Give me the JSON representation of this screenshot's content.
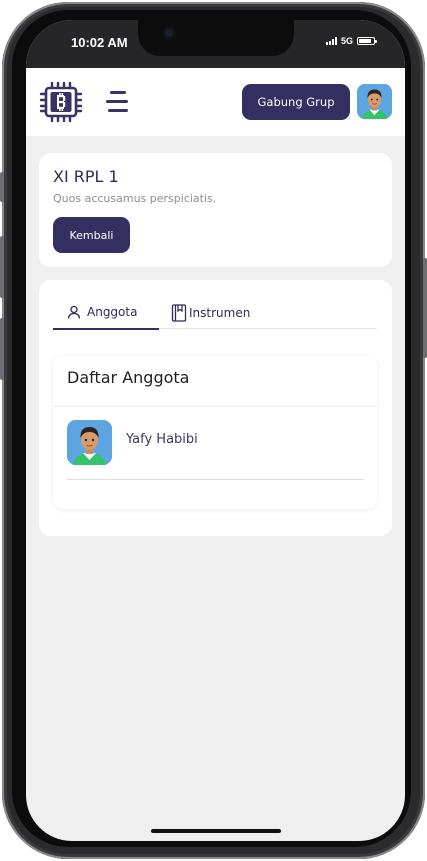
{
  "status_bar": {
    "time": "10:02 AM",
    "network": "5G",
    "battery_level": 0.85
  },
  "header": {
    "logo_icon": "bitcoin-chip-logo",
    "menu_icon": "hamburger-menu-icon",
    "join_group_label": "Gabung Grup",
    "accent": "#332f60"
  },
  "group": {
    "title": "XI RPL 1",
    "description": "Quos accusamus perspiciatis.",
    "back_label": "Kembali"
  },
  "tabs": [
    {
      "label": "Anggota",
      "icon": "user-icon",
      "active": true
    },
    {
      "label": "Instrumen",
      "icon": "book-icon",
      "active": false
    }
  ],
  "members": {
    "heading": "Daftar Anggota",
    "items": [
      {
        "name": "Yafy Habibi",
        "avatar": "avatar-icon"
      }
    ]
  }
}
